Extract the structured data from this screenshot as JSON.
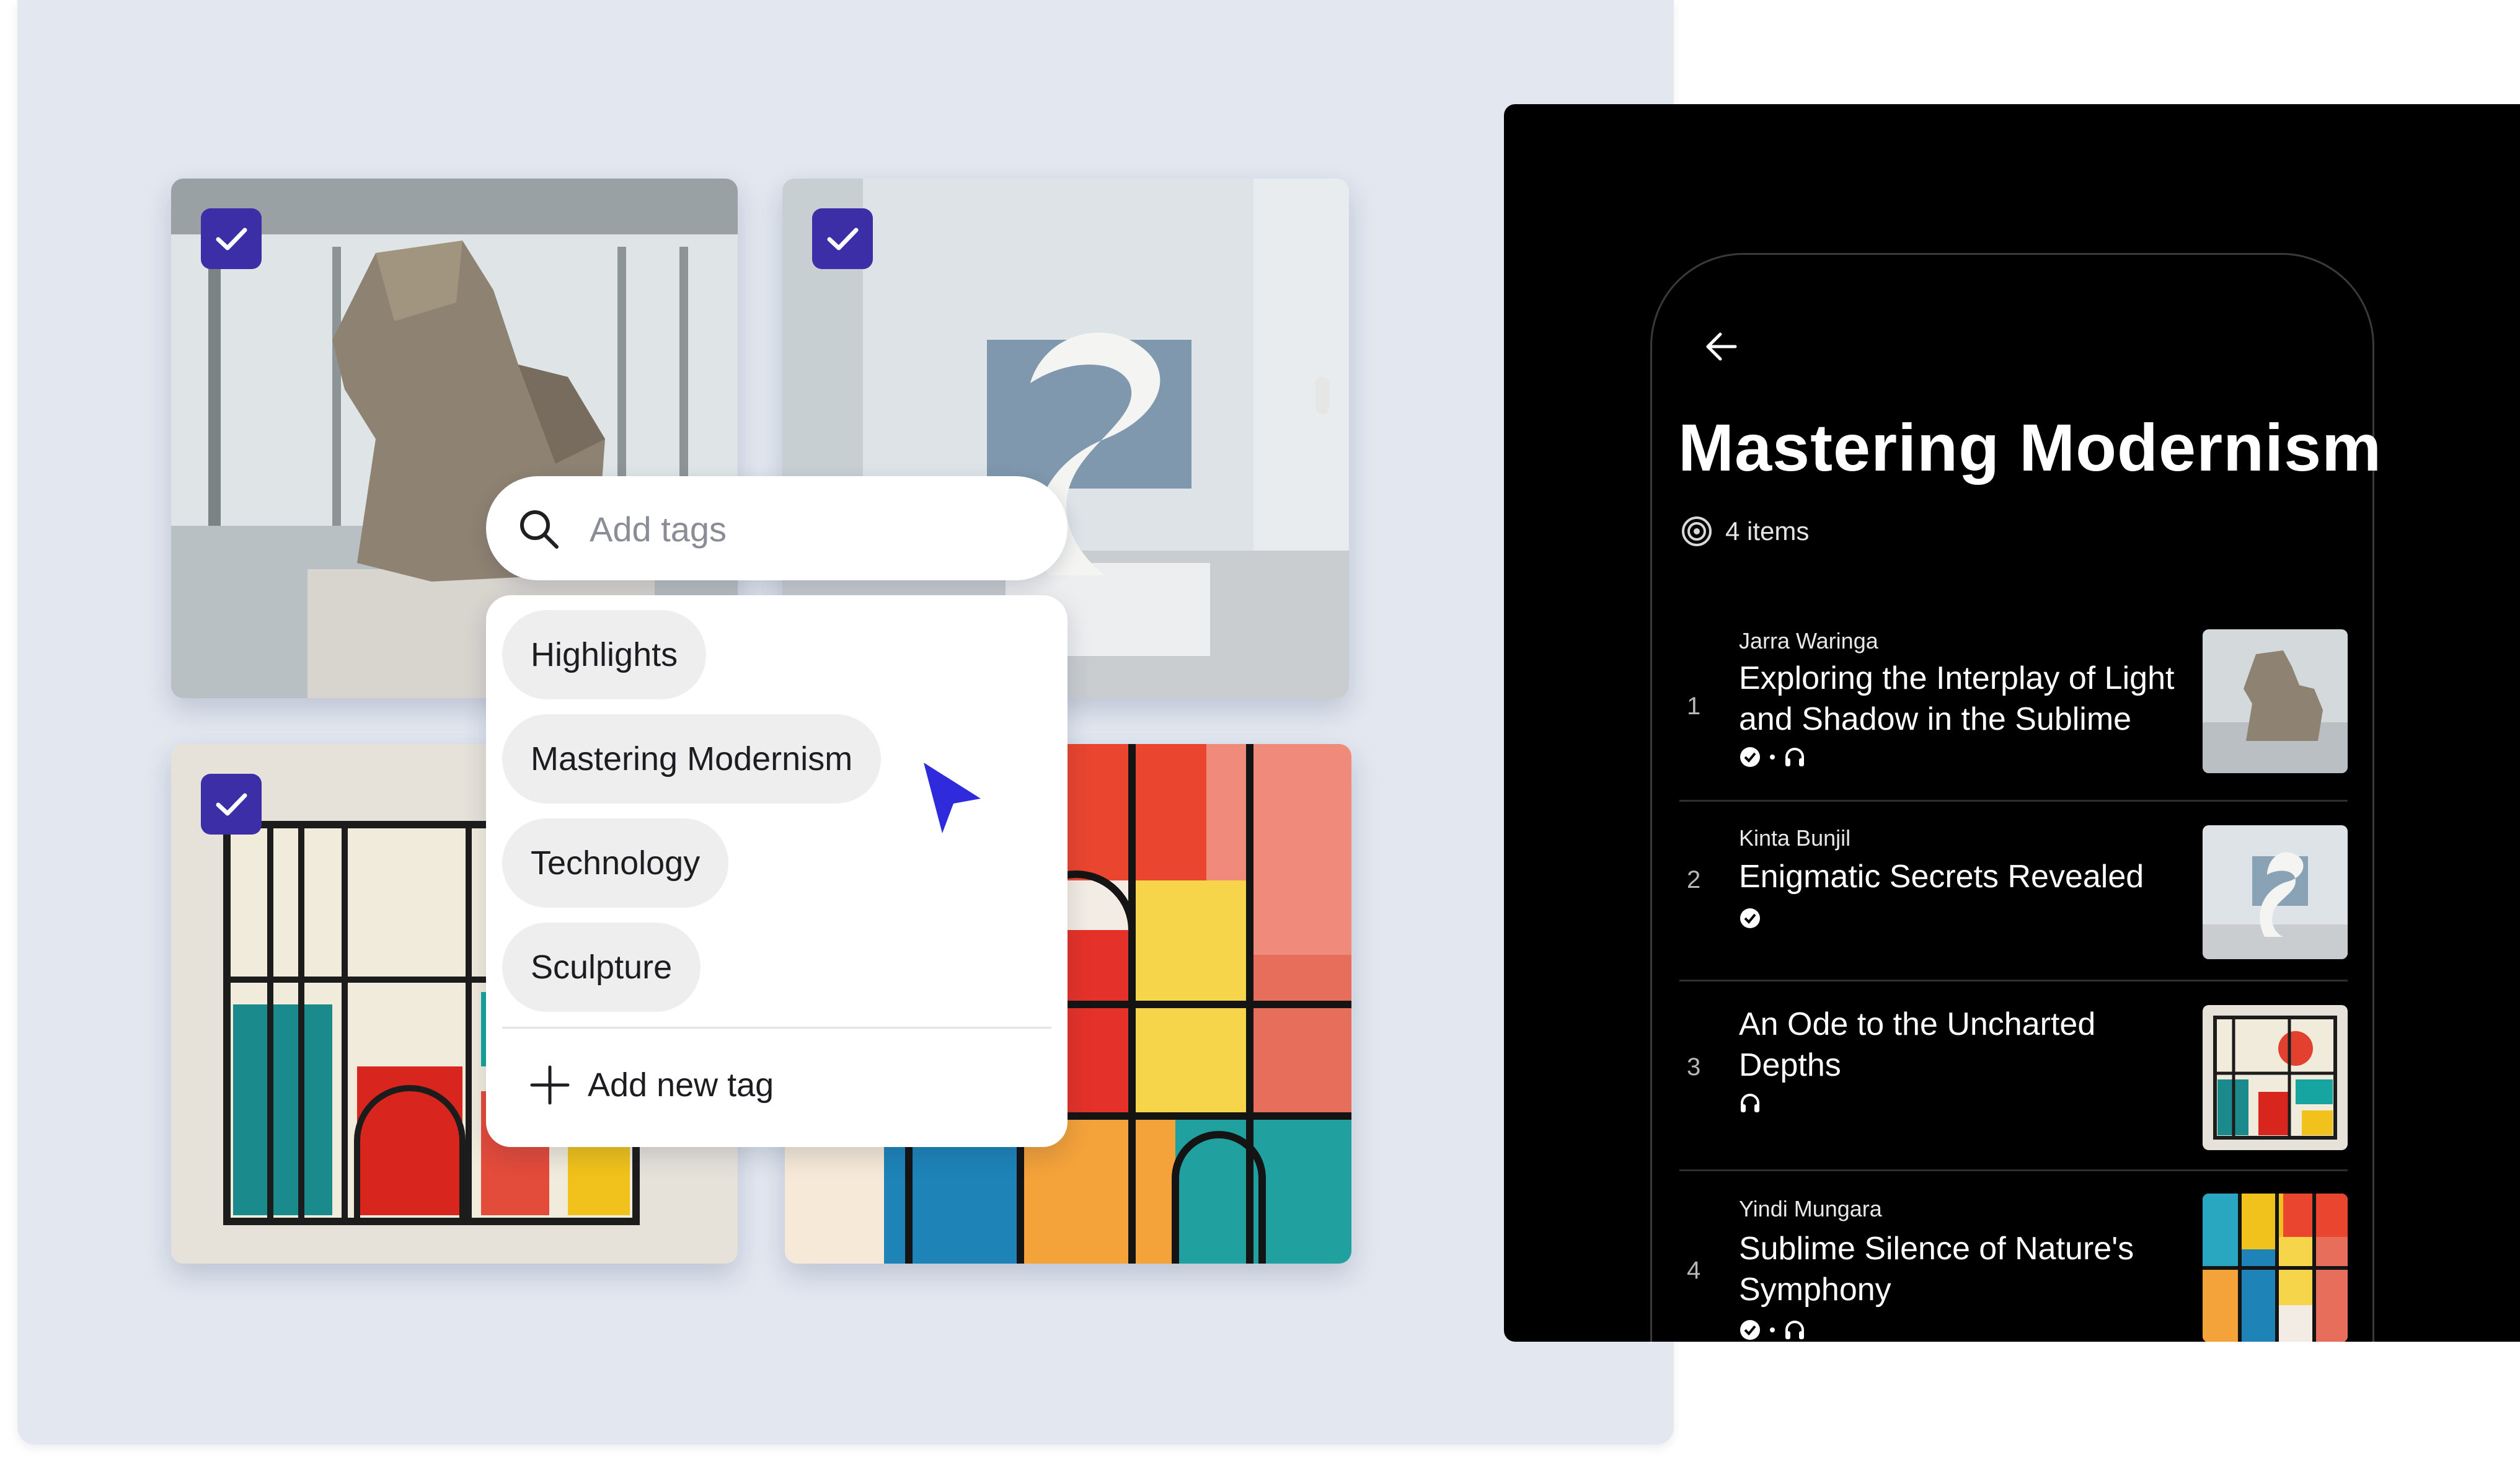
{
  "search": {
    "placeholder": "Add tags"
  },
  "tags": [
    "Highlights",
    "Mastering Modernism",
    "Technology",
    "Sculpture"
  ],
  "add_tag_label": "Add new tag",
  "gallery": {
    "tiles": [
      {
        "subject": "abstract stone horse sculpture in gallery",
        "selected": true
      },
      {
        "subject": "white swirl sculpture in gallery",
        "selected": true
      },
      {
        "subject": "geometric stained glass style painting",
        "selected": true
      },
      {
        "subject": "colorful abstract stained glass figure",
        "selected": false
      }
    ]
  },
  "playlist": {
    "title": "Mastering Modernism",
    "count": "4 items",
    "items": [
      {
        "num": "1",
        "author": "Jarra Waringa",
        "title": "Exploring the Interplay of Light and Shadow in the Sublime",
        "icons": [
          "verified-icon",
          "headphones-icon"
        ]
      },
      {
        "num": "2",
        "author": "Kinta Bunjil",
        "title": "Enigmatic Secrets Revealed",
        "icons": [
          "verified-icon"
        ]
      },
      {
        "num": "3",
        "author": "",
        "title": "An Ode to the Uncharted Depths",
        "icons": [
          "headphones-icon"
        ]
      },
      {
        "num": "4",
        "author": "Yindi Mungara",
        "title": "Sublime Silence of Nature's Symphony",
        "icons": [
          "verified-icon",
          "headphones-icon"
        ]
      }
    ]
  },
  "colors": {
    "accent": "#3c2ea6",
    "cursor": "#2f2bdc",
    "panel_bg": "#e2e7f0",
    "phone_bg": "#000000"
  }
}
